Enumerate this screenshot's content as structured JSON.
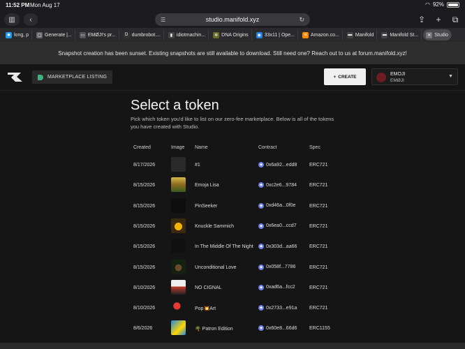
{
  "status": {
    "time": "11:52 PM",
    "date": "Mon Aug 17",
    "battery": "92%"
  },
  "browser": {
    "url": "studio.manifold.xyz"
  },
  "tabs": [
    {
      "label": "long, p",
      "color": "#1d9bf0",
      "glyph": "✱"
    },
    {
      "label": "Generate |...",
      "color": "#666",
      "glyph": "▢"
    },
    {
      "label": "EMØJI's pr...",
      "color": "#555",
      "glyph": "▭"
    },
    {
      "label": "dumbrobot....",
      "color": "#333",
      "glyph": "D"
    },
    {
      "label": "idiotmachin...",
      "color": "#444",
      "glyph": "▮"
    },
    {
      "label": "DNA Origins",
      "color": "#6a6a2a",
      "glyph": "✲"
    },
    {
      "label": "33x11 | Ope...",
      "color": "#2081e2",
      "glyph": "◉"
    },
    {
      "label": "Amazon.co...",
      "color": "#ff8a00",
      "glyph": "a"
    },
    {
      "label": "Manifold",
      "color": "#444",
      "glyph": "▬"
    },
    {
      "label": "Manifold St...",
      "color": "#444",
      "glyph": "▬"
    },
    {
      "label": "Studio",
      "color": "#777",
      "glyph": "✕"
    }
  ],
  "banner": {
    "text": "Snapshot creation has been sunset. Existing snapshots are still available to download. Still need one? Reach out to us at forum.manifold.xyz!"
  },
  "header": {
    "marketplace_label": "MARKETPLACE LISTING",
    "create_label": "CREATE",
    "account_name": "EMOJI",
    "account_handle": "EMØJI"
  },
  "page": {
    "title": "Select a token",
    "description": "Pick which token you'd like to list on our zero-fee marketplace. Below is all of the tokens you have created with Studio."
  },
  "table": {
    "headers": {
      "created": "Created",
      "image": "Image",
      "name": "Name",
      "contract": "Contract",
      "spec": "Spec"
    },
    "rows": [
      {
        "created": "8/17/2026",
        "name": "#1",
        "contract": "0x6a92...edd8",
        "spec": "ERC721"
      },
      {
        "created": "8/15/2026",
        "name": "Emoja Lisa",
        "contract": "0xc2e6...9784",
        "spec": "ERC721"
      },
      {
        "created": "8/15/2026",
        "name": "PinSeeker",
        "contract": "0xd46a...0f0e",
        "spec": "ERC721"
      },
      {
        "created": "8/15/2026",
        "name": "Knuckle Sammich",
        "contract": "0x6ea0...ccd7",
        "spec": "ERC721"
      },
      {
        "created": "8/15/2026",
        "name": "In The Middle Of The Night",
        "contract": "0x303d...aa66",
        "spec": "ERC721"
      },
      {
        "created": "8/15/2026",
        "name": "Unconditional Love",
        "contract": "0x058f...7786",
        "spec": "ERC721"
      },
      {
        "created": "8/10/2026",
        "name": "NO CIGNAL",
        "contract": "0xad6a...fcc2",
        "spec": "ERC721"
      },
      {
        "created": "8/10/2026",
        "name": "Pop💥Art",
        "contract": "0x2733...e91a",
        "spec": "ERC721"
      },
      {
        "created": "8/6/2026",
        "name": "🌴 Patron Edition",
        "contract": "0x60e8...66d6",
        "spec": "ERC1155"
      }
    ]
  }
}
